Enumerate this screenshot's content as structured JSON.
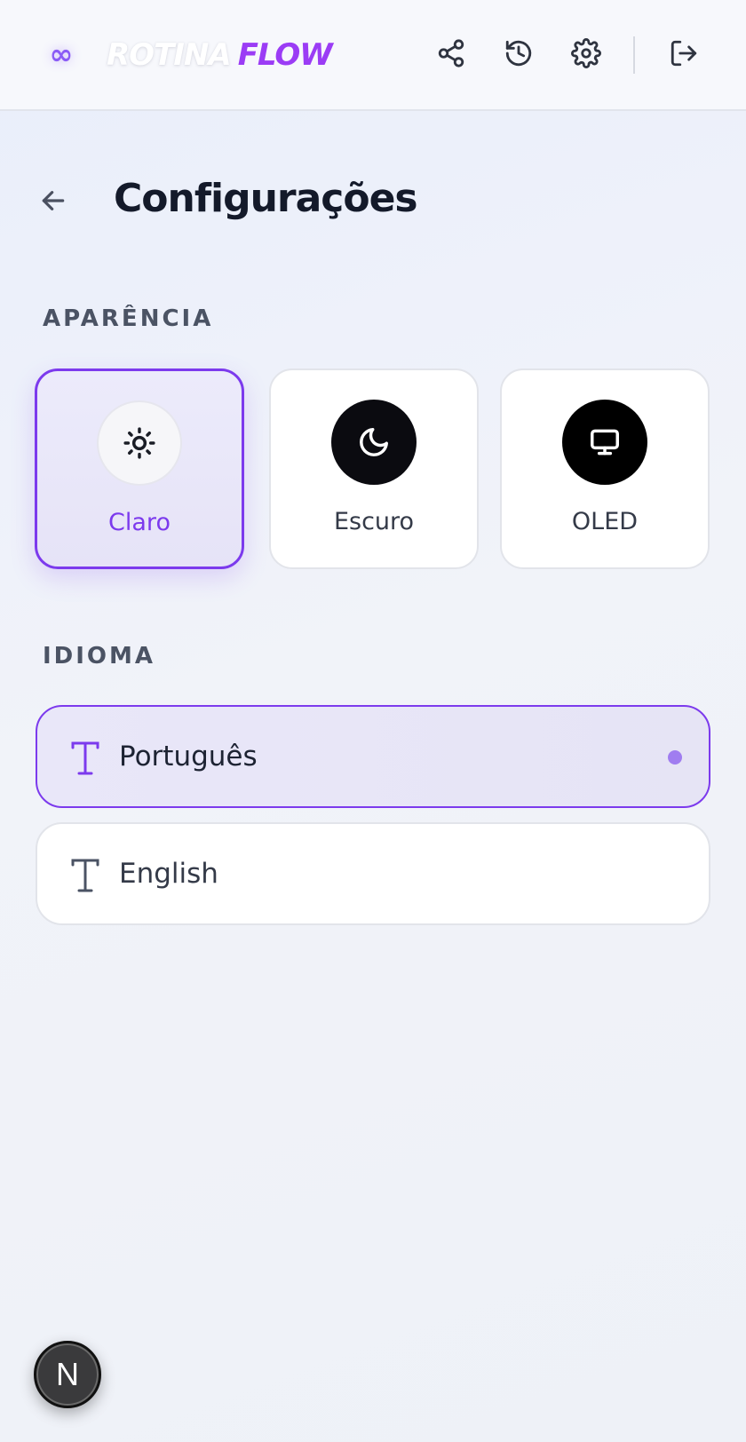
{
  "header": {
    "logo_part1": "ROTINA",
    "logo_part2": "FLOW",
    "logo_mark": "∞",
    "icons": [
      "share-icon",
      "history-icon",
      "settings-icon",
      "logout-icon"
    ]
  },
  "page": {
    "title": "Configurações"
  },
  "appearance": {
    "section_label": "APARÊNCIA",
    "options": [
      {
        "label": "Claro",
        "icon": "sun-icon",
        "selected": true
      },
      {
        "label": "Escuro",
        "icon": "moon-icon",
        "selected": false
      },
      {
        "label": "OLED",
        "icon": "monitor-icon",
        "selected": false
      }
    ]
  },
  "language": {
    "section_label": "IDIOMA",
    "options": [
      {
        "label": "Português",
        "icon": "type-icon",
        "selected": true
      },
      {
        "label": "English",
        "icon": "type-icon",
        "selected": false
      }
    ]
  },
  "dev_badge": {
    "label": "N"
  },
  "colors": {
    "accent": "#7c3aed",
    "logo_accent": "#9b3cf5",
    "dark_circle": "#0b0b10",
    "title": "#141a2a"
  }
}
